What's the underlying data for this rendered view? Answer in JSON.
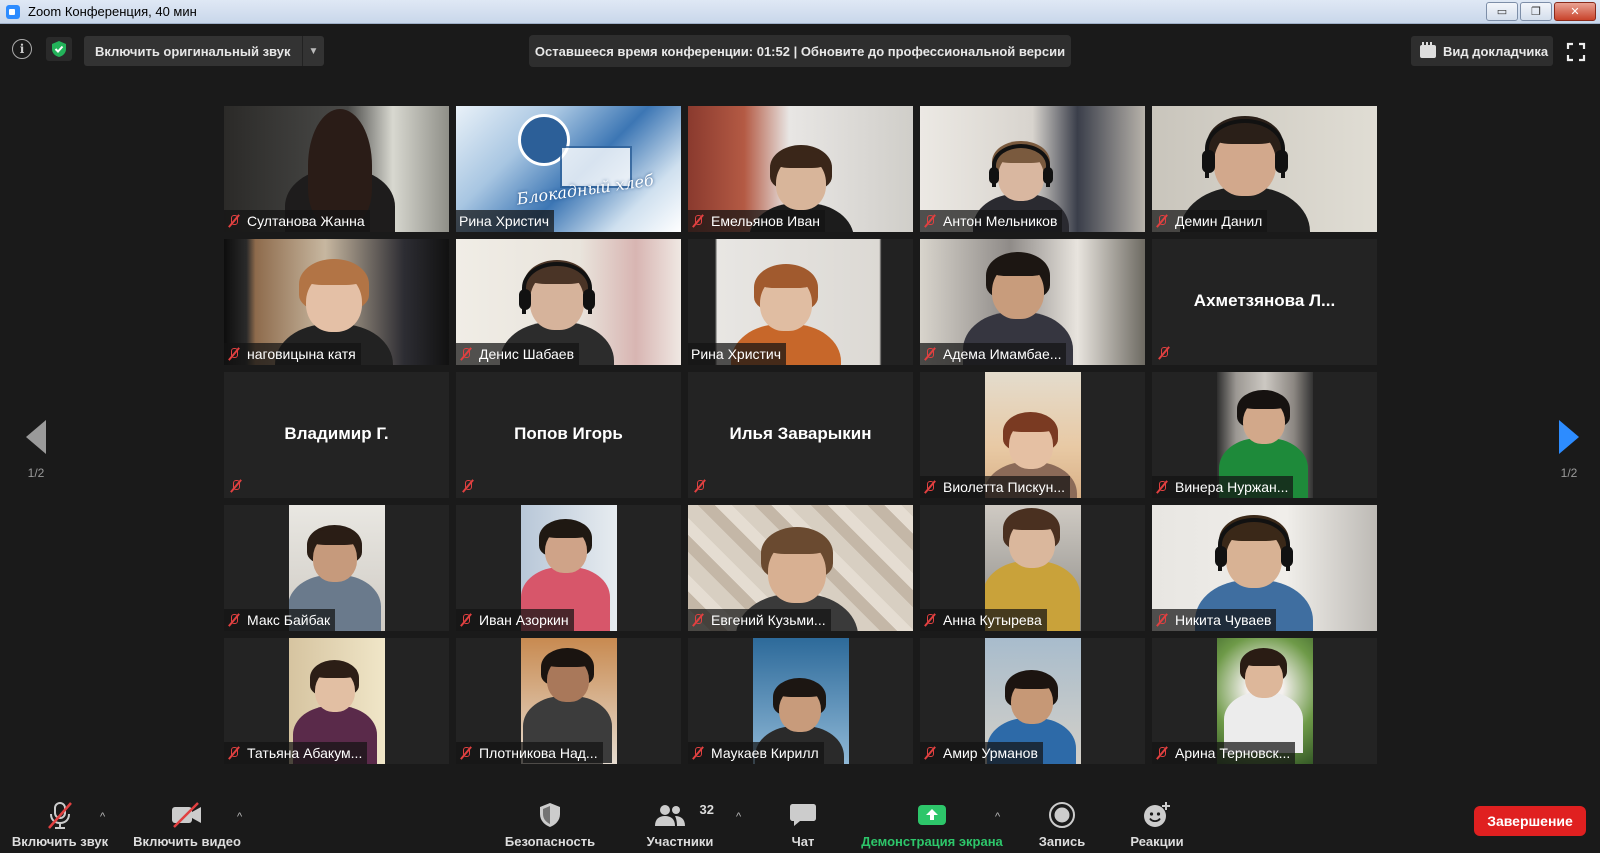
{
  "window": {
    "title": "Zoom Конференция, 40 мин",
    "minimize": "▭",
    "restore": "❐",
    "close": "✕"
  },
  "topbar": {
    "info_icon": "i",
    "original_sound": "Включить оригинальный звук",
    "remaining_time": "Оставшееся время конференции: 01:52 | Обновите до профессиональной версии",
    "speaker_view": "Вид докладчика"
  },
  "paging": {
    "left_page": "1/2",
    "right_page": "1/2"
  },
  "participants": [
    {
      "name": "Султанова Жанна",
      "video": true
    },
    {
      "name": "Рина Христич",
      "video": true,
      "muted": false,
      "shared_image_text": "Блокадный хлеб"
    },
    {
      "name": "Емельянов Иван",
      "video": true
    },
    {
      "name": "Антон Мельников",
      "video": true
    },
    {
      "name": "Демин Данил",
      "video": true
    },
    {
      "name": "наговицына катя",
      "video": true
    },
    {
      "name": "Денис Шабаев",
      "video": true
    },
    {
      "name": "Рина Христич",
      "video": true,
      "muted": false,
      "active": true
    },
    {
      "name": "Адема Имамбае...",
      "video": true
    },
    {
      "name": "Ахметзянова  Л...",
      "video": false
    },
    {
      "name": "Владимир Г.",
      "video": false
    },
    {
      "name": "Попов Игорь",
      "video": false
    },
    {
      "name": "Илья Заварыкин",
      "video": false
    },
    {
      "name": "Виолетта Пискун...",
      "video": true
    },
    {
      "name": "Винера Нуржан...",
      "video": true
    },
    {
      "name": "Макс Байбак",
      "video": true
    },
    {
      "name": "Иван Азоркин",
      "video": true
    },
    {
      "name": "Евгений Кузьми...",
      "video": true
    },
    {
      "name": "Анна Кутырева",
      "video": true
    },
    {
      "name": "Никита Чуваев",
      "video": true
    },
    {
      "name": "Татьяна Абакум...",
      "video": true
    },
    {
      "name": "Плотникова Над...",
      "video": true
    },
    {
      "name": "Маукаев Кирилл",
      "video": true
    },
    {
      "name": "Амир Урманов",
      "video": true
    },
    {
      "name": "Арина Терновск...",
      "video": true
    }
  ],
  "toolbar": {
    "unmute": "Включить звук",
    "start_video": "Включить видео",
    "security": "Безопасность",
    "participants": "Участники",
    "participants_count": "32",
    "chat": "Чат",
    "share_screen": "Демонстрация экрана",
    "record": "Запись",
    "reactions": "Реакции",
    "end": "Завершение",
    "caret": "^"
  },
  "colors": {
    "background": "#1a1a1a",
    "tile": "#232323",
    "active_border": "#d6e66c",
    "share_green": "#2dc66a",
    "end_red": "#e02020",
    "muted_red": "#e04040",
    "page_arrow_blue": "#2d8cff"
  }
}
